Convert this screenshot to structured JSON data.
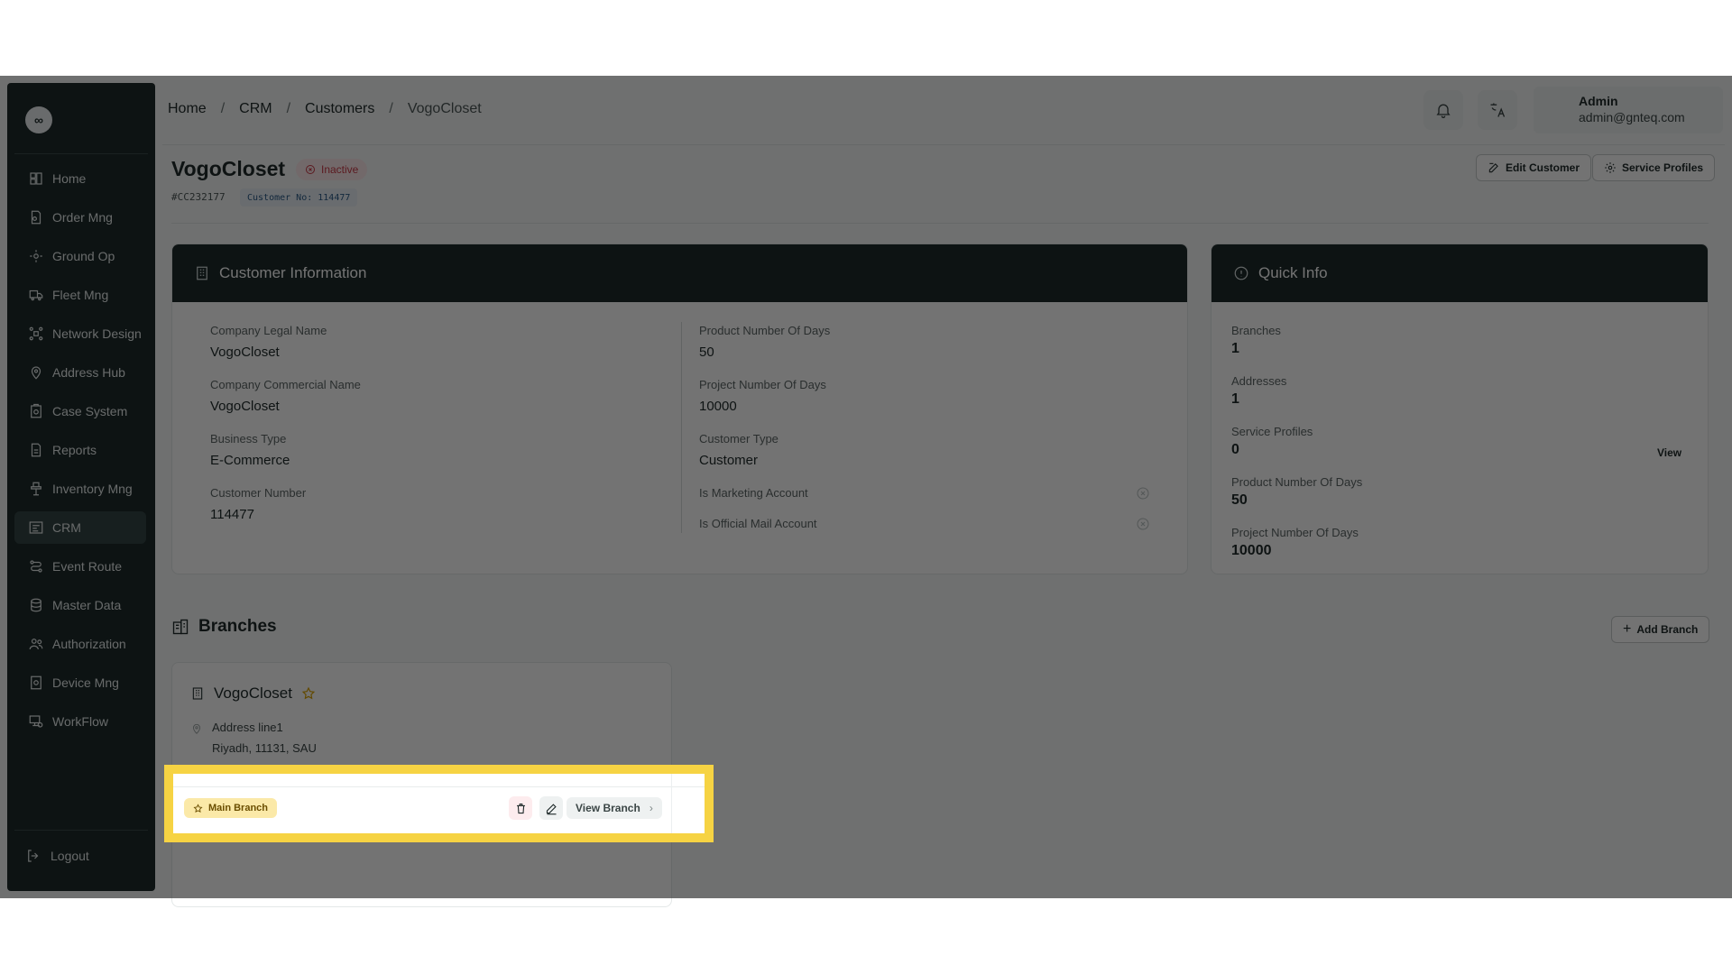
{
  "sidebar": {
    "logo": "∞",
    "items": [
      {
        "label": "Home",
        "icon": "home-icon"
      },
      {
        "label": "Order Mng",
        "icon": "order-icon"
      },
      {
        "label": "Ground Op",
        "icon": "ground-op-icon"
      },
      {
        "label": "Fleet Mng",
        "icon": "truck-icon"
      },
      {
        "label": "Network Design",
        "icon": "network-icon"
      },
      {
        "label": "Address Hub",
        "icon": "map-pin-icon"
      },
      {
        "label": "Case System",
        "icon": "case-icon"
      },
      {
        "label": "Reports",
        "icon": "report-icon"
      },
      {
        "label": "Inventory Mng",
        "icon": "inventory-icon"
      },
      {
        "label": "CRM",
        "icon": "crm-icon",
        "active": true
      },
      {
        "label": "Event Route",
        "icon": "route-icon"
      },
      {
        "label": "Master Data",
        "icon": "database-icon"
      },
      {
        "label": "Authorization",
        "icon": "users-icon"
      },
      {
        "label": "Device Mng",
        "icon": "device-icon"
      },
      {
        "label": "WorkFlow",
        "icon": "workflow-icon"
      }
    ],
    "logout": "Logout"
  },
  "header": {
    "breadcrumb": [
      "Home",
      "CRM",
      "Customers",
      "VogoCloset"
    ],
    "separator": "/",
    "user": {
      "name": "Admin",
      "email": "admin@gnteq.com"
    }
  },
  "customer": {
    "name": "VogoCloset",
    "status": "Inactive",
    "code": "#CC232177",
    "customer_no_tag": "Customer No: 114477",
    "edit_button": "Edit Customer",
    "service_profiles_button": "Service Profiles"
  },
  "info_card": {
    "title": "Customer Information",
    "left": [
      {
        "label": "Company Legal Name",
        "value": "VogoCloset"
      },
      {
        "label": "Company Commercial Name",
        "value": "VogoCloset"
      },
      {
        "label": "Business Type",
        "value": "E-Commerce"
      },
      {
        "label": "Customer Number",
        "value": "114477"
      }
    ],
    "right": [
      {
        "label": "Product Number Of Days",
        "value": "50"
      },
      {
        "label": "Project Number Of Days",
        "value": "10000"
      },
      {
        "label": "Customer Type",
        "value": "Customer"
      }
    ],
    "flags": [
      {
        "label": "Is Marketing Account"
      },
      {
        "label": "Is Official Mail Account"
      }
    ]
  },
  "quick_info": {
    "title": "Quick Info",
    "items": [
      {
        "label": "Branches",
        "value": "1"
      },
      {
        "label": "Addresses",
        "value": "1"
      },
      {
        "label": "Service Profiles",
        "value": "0"
      },
      {
        "label": "Product Number Of Days",
        "value": "50"
      },
      {
        "label": "Project Number Of Days",
        "value": "10000"
      }
    ],
    "view_link": "View"
  },
  "branches": {
    "title": "Branches",
    "add_button": "Add Branch",
    "list": [
      {
        "name": "VogoCloset",
        "address_line1": "Address line1",
        "address_line2": "Riyadh, 11131, SAU",
        "badge": "Main Branch",
        "view_button": "View Branch"
      }
    ]
  },
  "colors": {
    "sidebar": "#1e2c2c",
    "highlight": "#f6d343",
    "inactive": "#c93b48"
  }
}
